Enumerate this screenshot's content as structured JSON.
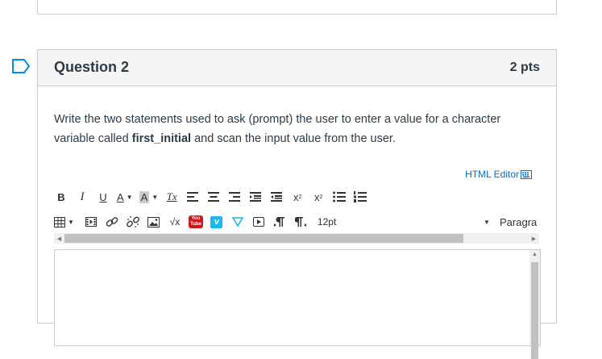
{
  "question": {
    "title": "Question 2",
    "points": "2 pts",
    "text_part1": "Write the two statements used to ask (prompt) the user to enter a value for a character  variable called ",
    "text_bold": "first_initial",
    "text_part2": " and scan the input value from the user."
  },
  "editor": {
    "html_editor_label": "HTML Editor",
    "font_size": "12pt",
    "paragraph": "Paragra",
    "toolbar_row1": [
      "B",
      "I",
      "U",
      "A",
      "A",
      "Tx",
      "align-left",
      "align-center",
      "align-right",
      "indent",
      "outdent",
      "superscript",
      "subscript",
      "bullet-list",
      "numbered-list"
    ],
    "toolbar_row2": [
      "table",
      "media",
      "link",
      "unlink",
      "image",
      "equation",
      "youtube",
      "vimeo",
      "direction-ltr",
      "direction-rtl",
      "paragraph-ltr",
      "paragraph-rtl"
    ],
    "youtube_label_top": "You",
    "youtube_label_bottom": "Tube",
    "vimeo_label": "v",
    "sqrt_label": "√x"
  },
  "colors": {
    "accent": "#0770a3",
    "flag": "#008ee2",
    "link": "#0070c9"
  }
}
